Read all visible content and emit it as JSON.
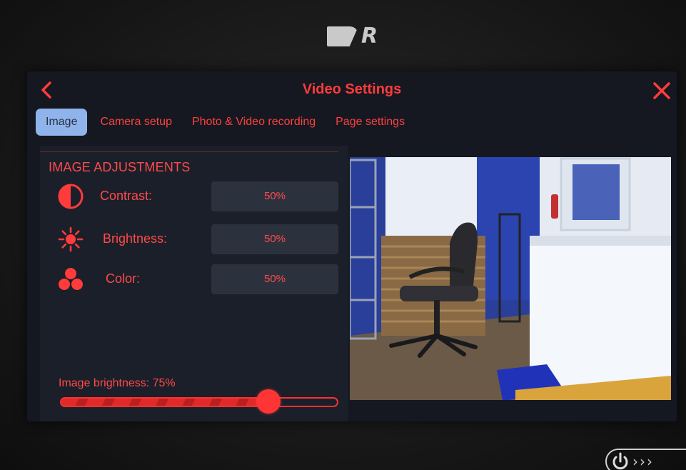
{
  "device": {
    "logo_letter": "R"
  },
  "window": {
    "title": "Video Settings"
  },
  "tabs": [
    {
      "label": "Image",
      "active": true
    },
    {
      "label": "Camera setup",
      "active": false
    },
    {
      "label": "Photo & Video recording",
      "active": false
    },
    {
      "label": "Page settings",
      "active": false
    }
  ],
  "image_adjustments": {
    "section_title": "IMAGE ADJUSTMENTS",
    "rows": [
      {
        "label": "Contrast:",
        "value": "50%",
        "icon": "contrast-icon"
      },
      {
        "label": "Brightness:",
        "value": "50%",
        "icon": "sun-icon"
      },
      {
        "label": "Color:",
        "value": "50%",
        "icon": "color-dots-icon"
      }
    ]
  },
  "image_brightness": {
    "label": "Image brightness: 75%",
    "level_percent": 75
  },
  "theme": {
    "accent": "#ff3b3b",
    "active_tab": "#8fb4ec",
    "panel": "#1b1f2a",
    "value_box": "#2c313e"
  },
  "icons": {
    "back": "chevron-left-icon",
    "close": "close-icon",
    "power": "power-icon",
    "more": "chevron-right-icon"
  }
}
